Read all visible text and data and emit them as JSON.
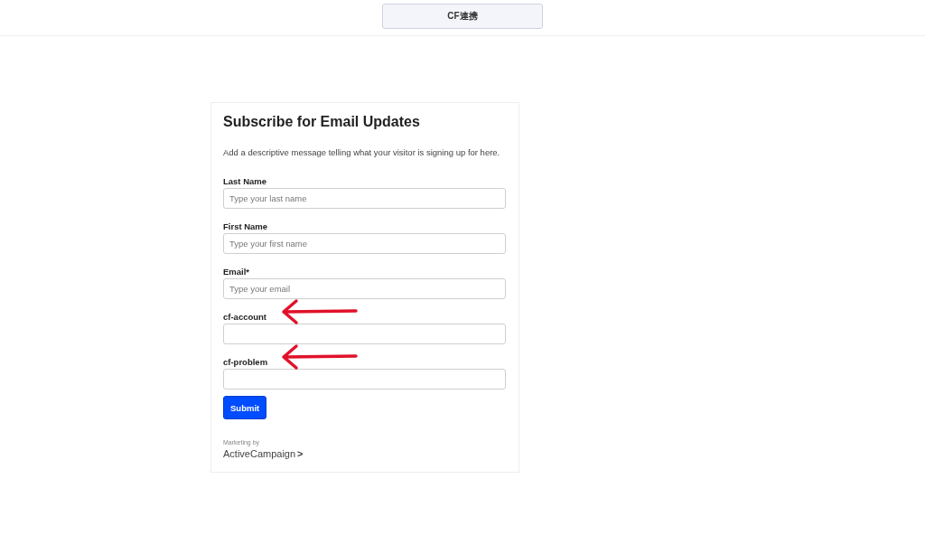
{
  "header": {
    "button": "CF連携"
  },
  "form": {
    "title": "Subscribe for Email Updates",
    "description": "Add a descriptive message telling what your visitor is signing up for here.",
    "fields": [
      {
        "label": "Last Name",
        "placeholder": "Type your last name",
        "marked": false
      },
      {
        "label": "First Name",
        "placeholder": "Type your first name",
        "marked": false
      },
      {
        "label": "Email*",
        "placeholder": "Type your email",
        "marked": false
      },
      {
        "label": "cf-account",
        "marked": true
      },
      {
        "label": "cf-problem",
        "marked": true
      }
    ],
    "submit": "Submit",
    "footer": {
      "caption": "Marketing by",
      "brand": "ActiveCampaign",
      "brand_mark": ">"
    }
  }
}
